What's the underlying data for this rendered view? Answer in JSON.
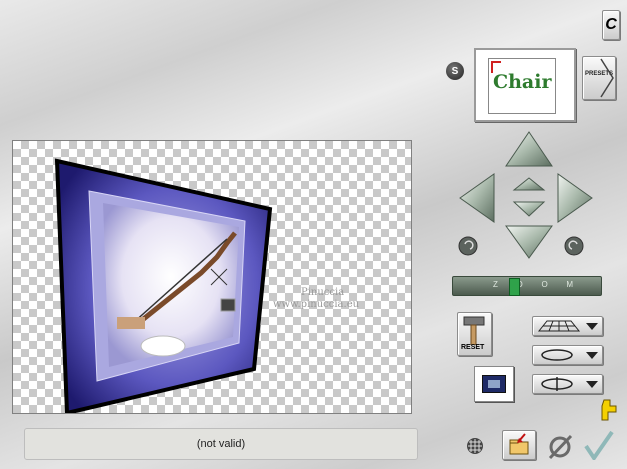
{
  "logo_letter": "C",
  "preset_thumb_text": "Chair",
  "s_button_label": "S",
  "presets_label": "PRESETS",
  "zoom_letters": [
    "Z",
    "O",
    "O",
    "M"
  ],
  "reset_label": "RESET",
  "status_text": "(not valid)",
  "preview": {
    "watermark_line1": "Pinuccia",
    "watermark_line2": "www.pinuccia.eu"
  },
  "icons": {
    "nav": [
      "arrow-up-icon",
      "arrow-left-icon",
      "arrow-right-icon",
      "arrow-down-icon",
      "move-up-small-icon",
      "move-down-small-icon",
      "rotate-left-icon",
      "rotate-right-icon"
    ],
    "dropdowns": [
      "perspective-grid-icon",
      "rotate-horizontal-icon",
      "rotate-axis-icon"
    ]
  },
  "colors": {
    "frame_blue": "#4a4aa8",
    "ok_check": "#8fb8b8",
    "hand_yellow": "#f4d000"
  }
}
